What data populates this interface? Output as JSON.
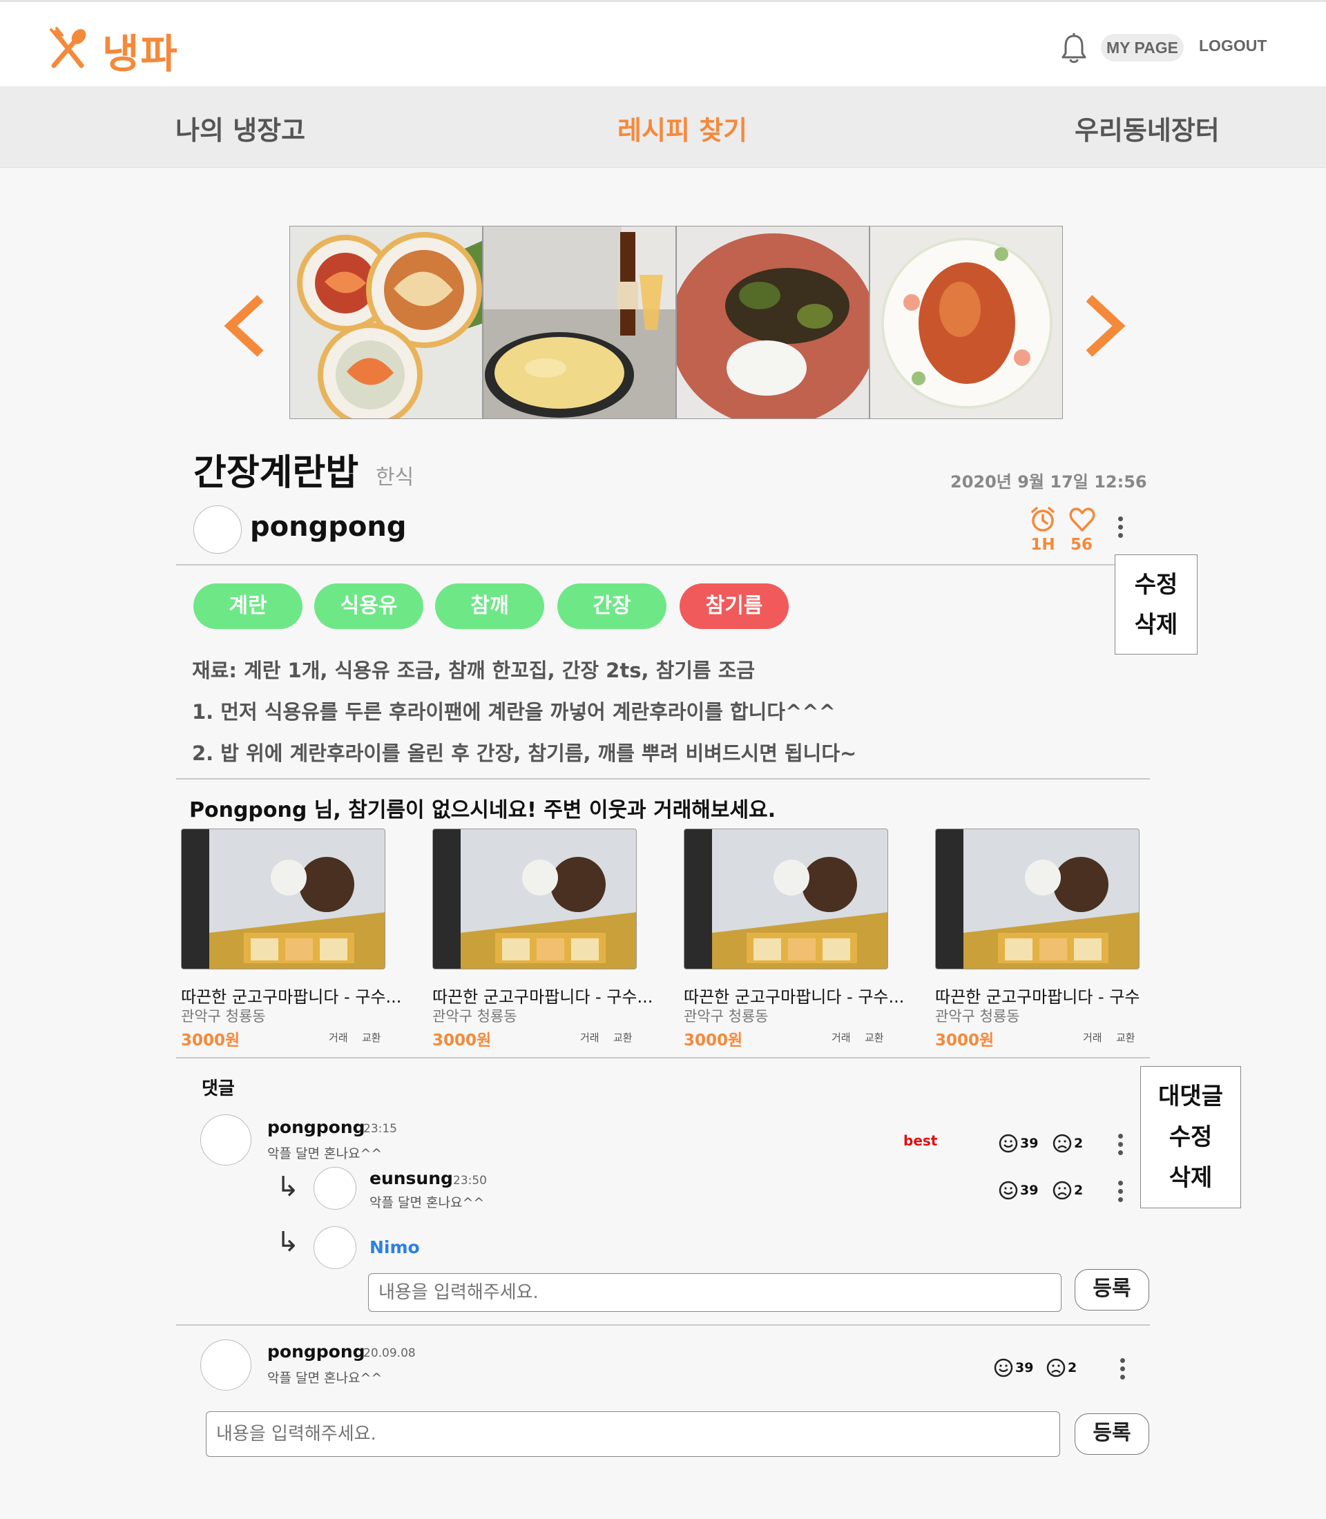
{
  "header": {
    "logo": "냉파",
    "mypage": "MY PAGE",
    "logout": "LOGOUT",
    "icons": [
      "fork-knife-icon",
      "bell-icon"
    ]
  },
  "nav": {
    "items": [
      "나의 냉장고",
      "레시피 찾기",
      "우리동네장터"
    ],
    "active_index": 1
  },
  "colors": {
    "accent": "#f5893a",
    "tag_have": "#6ee787",
    "tag_missing": "#f15a5a",
    "best": "#e01010",
    "reply_name": "#2d7fe5"
  },
  "recipe": {
    "title": "간장계란밥",
    "category": "한식",
    "date": "2020년 9월 17일 12:56",
    "author": "pongpong",
    "time": "1H",
    "likes": "56",
    "menu": {
      "edit": "수정",
      "delete": "삭제"
    },
    "tags": [
      {
        "label": "계란",
        "missing": false
      },
      {
        "label": "식용유",
        "missing": false
      },
      {
        "label": "참깨",
        "missing": false
      },
      {
        "label": "간장",
        "missing": false
      },
      {
        "label": "참기름",
        "missing": true
      }
    ],
    "ingredients": "재료: 계란 1개, 식용유 조금, 참깨 한꼬집, 간장 2ts, 참기름 조금",
    "steps": [
      "1. 먼저 식용유를 두른 후라이팬에 계란을 까넣어 계란후라이를 합니다^^^",
      "2. 밥 위에 계란후라이를 올린 후 간장, 참기름, 깨를 뿌려 비벼드시면 됩니다~"
    ]
  },
  "suggestion": {
    "title": "Pongpong 님, 참기름이 없으시네요! 주변 이웃과 거래해보세요.",
    "products": [
      {
        "name": "따끈한 군고구마팝니다 - 구수...",
        "location": "관악구 청룡동",
        "price": "3000원",
        "trade": "거래",
        "exchange": "교환"
      },
      {
        "name": "따끈한 군고구마팝니다 - 구수...",
        "location": "관악구 청룡동",
        "price": "3000원",
        "trade": "거래",
        "exchange": "교환"
      },
      {
        "name": "따끈한 군고구마팝니다 - 구수...",
        "location": "관악구 청룡동",
        "price": "3000원",
        "trade": "거래",
        "exchange": "교환"
      },
      {
        "name": "따끈한 군고구마팝니다 - 구수",
        "location": "관악구 청룡동",
        "price": "3000원",
        "trade": "거래",
        "exchange": "교환"
      }
    ]
  },
  "comments": {
    "title": "댓글",
    "menu": {
      "reply": "대댓글",
      "edit": "수정",
      "delete": "삭제"
    },
    "best_label": "best",
    "items": [
      {
        "name": "pongpong",
        "time": "23:15",
        "body": "악플 달면 혼나요^^",
        "likes": "39",
        "dislikes": "2"
      },
      {
        "name": "eunsung",
        "time": "23:50",
        "body": "악플 달면 혼나요^^",
        "likes": "39",
        "dislikes": "2"
      },
      {
        "name": "pongpong",
        "time": "20.09.08",
        "body": "악플 달면 혼나요^^",
        "likes": "39",
        "dislikes": "2"
      }
    ],
    "reply_user": "Nimo",
    "input_placeholder": "내용을 입력해주세요.",
    "submit": "등록"
  }
}
